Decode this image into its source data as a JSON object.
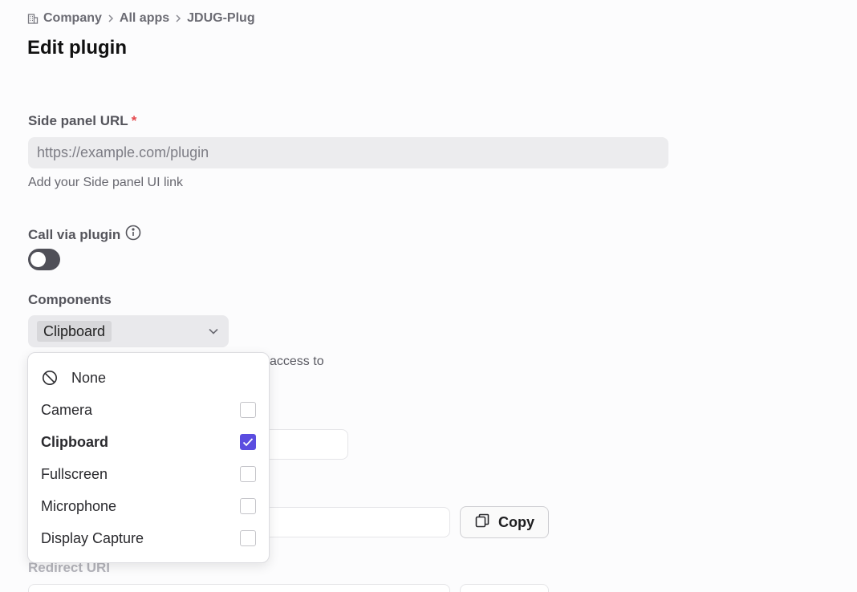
{
  "breadcrumb": {
    "items": [
      "Company",
      "All apps",
      "JDUG-Plug"
    ]
  },
  "page": {
    "title": "Edit plugin"
  },
  "side_panel": {
    "label": "Side panel URL",
    "required_mark": "*",
    "placeholder": "https://example.com/plugin",
    "helper": "Add your Side panel UI link"
  },
  "call_via_plugin": {
    "label": "Call via plugin",
    "enabled": false
  },
  "components": {
    "label": "Components",
    "selected_chip": "Clipboard",
    "helper_visible_fragment": "access to",
    "options": [
      {
        "label": "None",
        "checked": false
      },
      {
        "label": "Camera",
        "checked": false
      },
      {
        "label": "Clipboard",
        "checked": true
      },
      {
        "label": "Fullscreen",
        "checked": false
      },
      {
        "label": "Microphone",
        "checked": false
      },
      {
        "label": "Display Capture",
        "checked": false
      }
    ]
  },
  "copy_button": {
    "label": "Copy"
  },
  "redirect": {
    "label": "Redirect URI"
  }
}
